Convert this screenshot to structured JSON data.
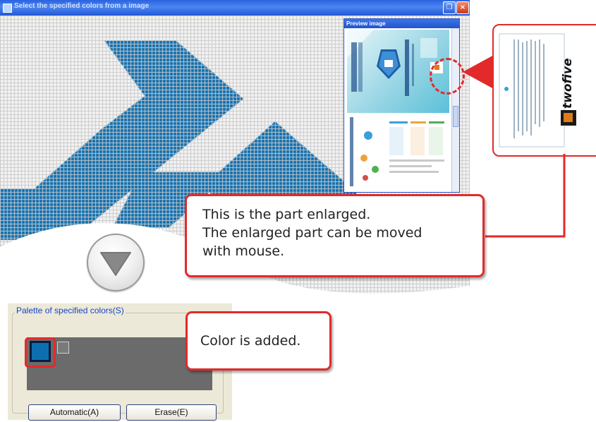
{
  "window": {
    "title": "Select the specified colors from a image",
    "maximize_glyph": "❐",
    "close_glyph": "×"
  },
  "canvas": {
    "grid_color": "#c8c8c8",
    "background_color": "#f4f4f4",
    "logo_color": "#0e6fb0"
  },
  "preview": {
    "title": "Preview image"
  },
  "zoom_brand": {
    "logo_text": "twofive"
  },
  "notes": {
    "enlarged_lines": [
      "This is the part enlarged.",
      "The enlarged part can be moved",
      "with mouse."
    ],
    "color_added": "Color is added."
  },
  "palette": {
    "legend": "Palette of specified colors(S)",
    "selected_color": "#0e6fb0",
    "automatic_label": "Automatic(A)",
    "erase_label": "Erase(E)"
  },
  "accent_red": "#e22a2a",
  "icons": [
    "app-icon",
    "maximize-icon",
    "close-icon",
    "down-arrow-icon"
  ]
}
